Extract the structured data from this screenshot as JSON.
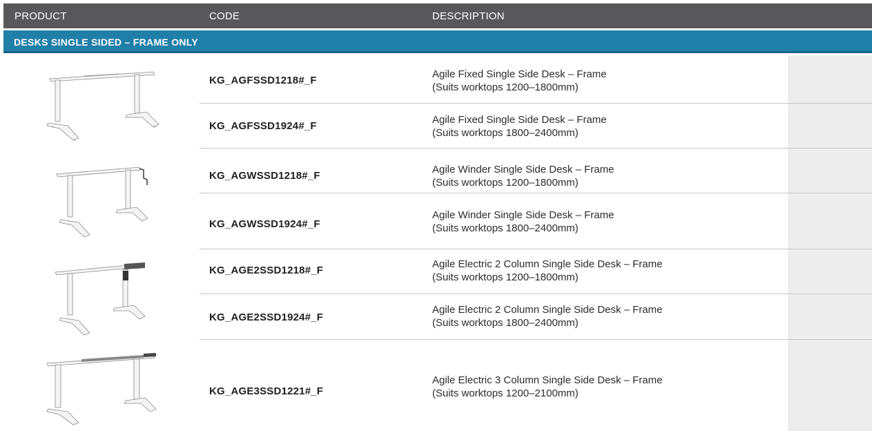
{
  "header": {
    "product_label": "PRODUCT",
    "code_label": "CODE",
    "description_label": "DESCRIPTION"
  },
  "section": {
    "title": "DESKS SINGLE SIDED – FRAME ONLY"
  },
  "products": [
    {
      "image_icon": "fixed-desk-frame-icon",
      "rows": [
        {
          "code": "KG_AGFSSD1218#_F",
          "desc_line1": "Agile Fixed Single Side Desk – Frame",
          "desc_line2": "(Suits worktops 1200–1800mm)"
        },
        {
          "code": "KG_AGFSSD1924#_F",
          "desc_line1": "Agile Fixed Single Side Desk – Frame",
          "desc_line2": "(Suits worktops 1800–2400mm)"
        }
      ]
    },
    {
      "image_icon": "winder-desk-frame-icon",
      "rows": [
        {
          "code": "KG_AGWSSD1218#_F",
          "desc_line1": "Agile Winder Single Side Desk – Frame",
          "desc_line2": "(Suits worktops 1200–1800mm)"
        },
        {
          "code": "KG_AGWSSD1924#_F",
          "desc_line1": "Agile Winder Single Side Desk – Frame",
          "desc_line2": "(Suits worktops 1800–2400mm)"
        }
      ]
    },
    {
      "image_icon": "electric-2-column-desk-frame-icon",
      "rows": [
        {
          "code": "KG_AGE2SSD1218#_F",
          "desc_line1": "Agile Electric 2 Column Single Side Desk – Frame",
          "desc_line2": "(Suits worktops 1200–1800mm)"
        },
        {
          "code": "KG_AGE2SSD1924#_F",
          "desc_line1": "Agile Electric 2 Column Single Side Desk – Frame",
          "desc_line2": "(Suits worktops 1800–2400mm)"
        }
      ]
    },
    {
      "image_icon": "electric-3-column-desk-frame-icon",
      "rows": [
        {
          "code": "KG_AGE3SSD1221#_F",
          "desc_line1": "Agile Electric 3 Column Single Side Desk – Frame",
          "desc_line2": "(Suits worktops 1200–2100mm)"
        }
      ]
    }
  ],
  "colors": {
    "header_bg": "#58585a",
    "section_bg": "#1f7fa9",
    "price_column_bg": "#ededed"
  }
}
